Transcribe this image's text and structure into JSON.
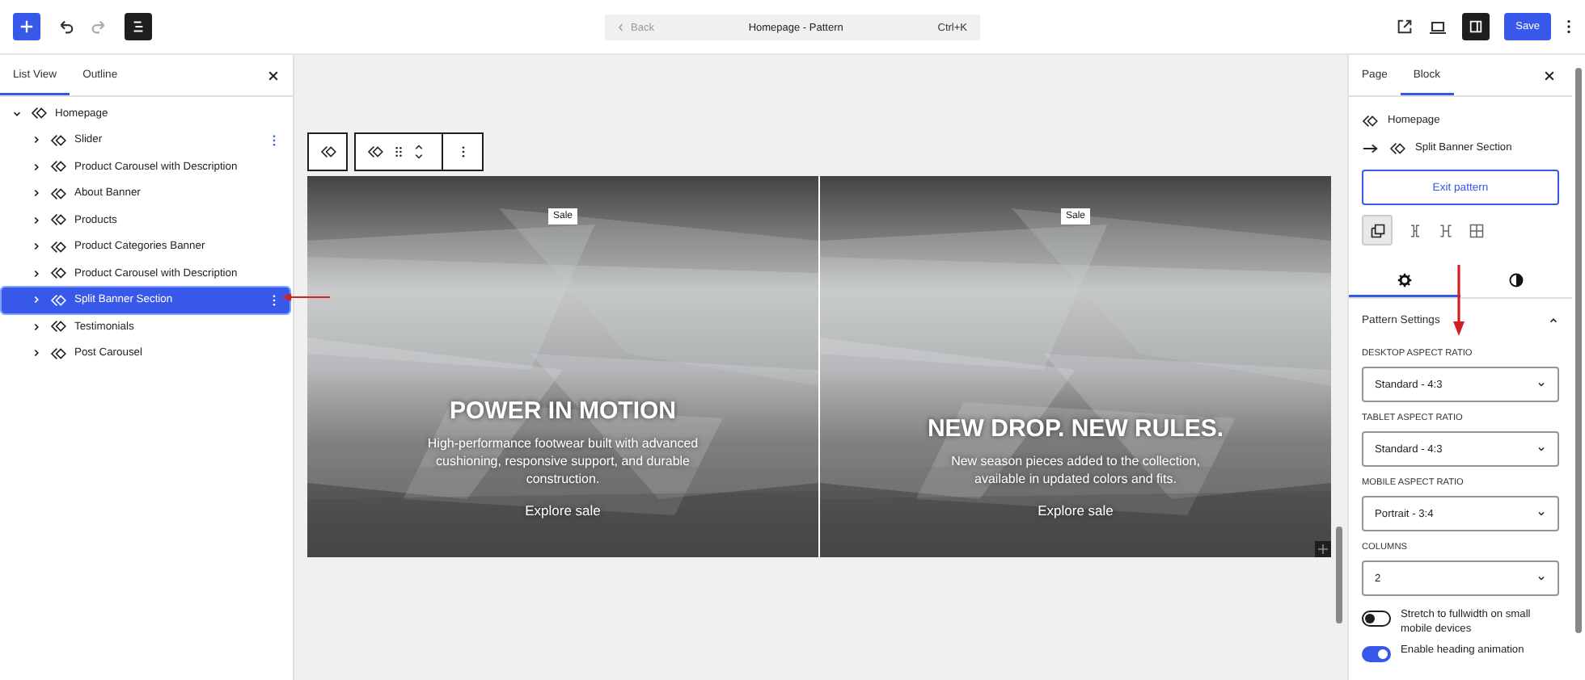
{
  "top_bar": {
    "command": {
      "back": "Back",
      "title": "Homepage - Pattern",
      "shortcut": "Ctrl+K"
    },
    "save": "Save"
  },
  "list_panel": {
    "tabs": [
      {
        "label": "List View",
        "selected": true
      },
      {
        "label": "Outline",
        "selected": false
      }
    ],
    "tree": [
      {
        "label": "Homepage",
        "expanded": true,
        "selected": false,
        "children": [
          {
            "label": "Slider",
            "expanded": false,
            "selected": false,
            "menu": true
          },
          {
            "label": "Product Carousel with Description",
            "expanded": false,
            "selected": false
          },
          {
            "label": "About Banner",
            "expanded": false,
            "selected": false
          },
          {
            "label": "Products",
            "expanded": false,
            "selected": false
          },
          {
            "label": "Product Categories Banner",
            "expanded": false,
            "selected": false
          },
          {
            "label": "Product Carousel with Description",
            "expanded": false,
            "selected": false
          },
          {
            "label": "Split Banner Section",
            "expanded": false,
            "selected": true,
            "menu": true
          },
          {
            "label": "Testimonials",
            "expanded": false,
            "selected": false
          },
          {
            "label": "Post Carousel",
            "expanded": false,
            "selected": false
          }
        ]
      }
    ]
  },
  "banners": [
    {
      "badge": "Sale",
      "heading": "POWER IN MOTION",
      "text": "High-performance footwear built with advanced cushioning, responsive support, and durable construction.",
      "link": "Explore sale"
    },
    {
      "badge": "Sale",
      "heading": "NEW DROP. NEW RULES.",
      "text": "New season pieces added to the collection, available in updated colors and fits.",
      "link": "Explore sale"
    }
  ],
  "inspector": {
    "tabs": [
      {
        "label": "Page",
        "selected": false
      },
      {
        "label": "Block",
        "selected": true
      }
    ],
    "breadcrumb": [
      "Homepage",
      "Split Banner Section"
    ],
    "exit_button": "Exit pattern",
    "view_tabs": [
      {
        "kind": "settings",
        "selected": true
      },
      {
        "kind": "styles",
        "selected": false
      }
    ],
    "section": {
      "title": "Pattern Settings",
      "expanded": true,
      "fields": [
        {
          "label": "DESKTOP ASPECT RATIO",
          "value": "Standard - 4:3"
        },
        {
          "label": "TABLET ASPECT RATIO",
          "value": "Standard - 4:3"
        },
        {
          "label": "MOBILE ASPECT RATIO",
          "value": "Portrait - 3:4"
        },
        {
          "label": "COLUMNS",
          "value": "2"
        }
      ],
      "toggles": [
        {
          "label": "Stretch to fullwidth on small mobile devices",
          "on": false
        },
        {
          "label": "Enable heading animation",
          "on": true
        }
      ]
    }
  }
}
